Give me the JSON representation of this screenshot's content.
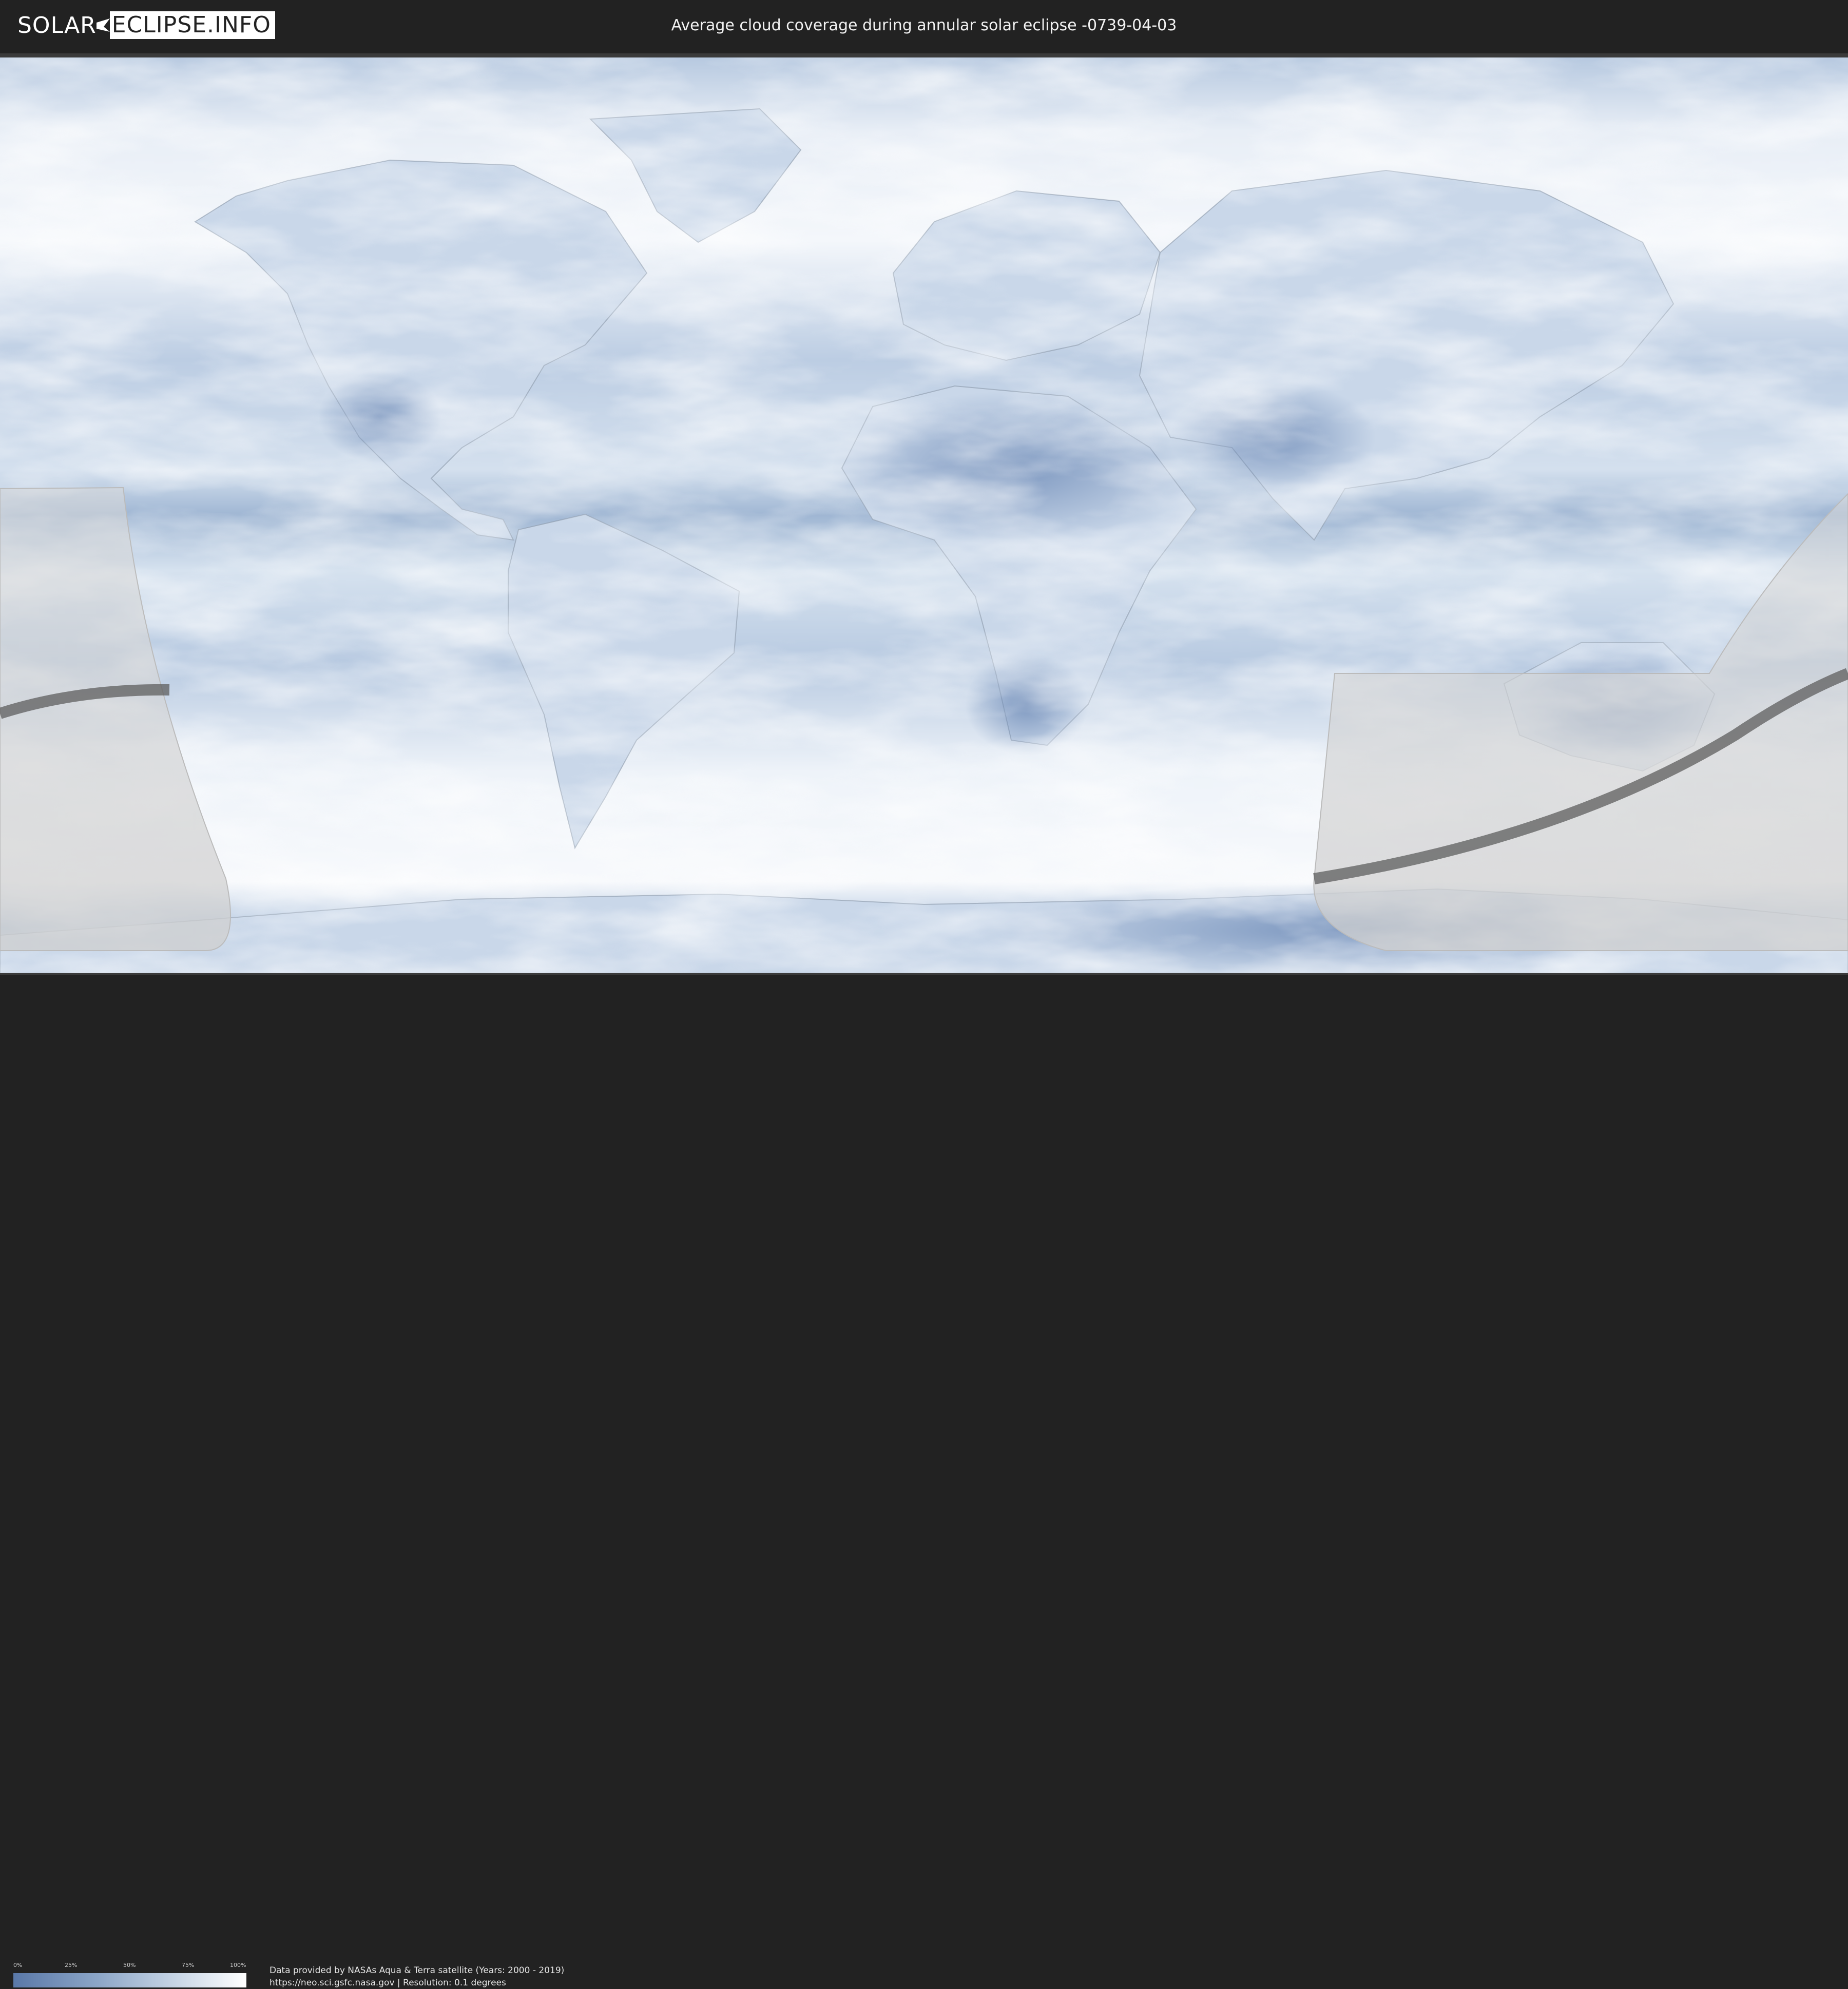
{
  "header": {
    "logo_part1": "SOLAR",
    "logo_part2": "ECLIPSE.INFO",
    "title": "Average cloud coverage during annular solar eclipse -0739-04-03"
  },
  "map": {
    "projection": "equirectangular",
    "ocean_base_color": "#c5d5e8",
    "clear_sky_color": "#5a78a8",
    "cloudy_color": "#ffffff",
    "eclipse_overlay_color": "#d9d9d9",
    "central_line_color": "#5e5e5e"
  },
  "legend": {
    "ticks": [
      "0%",
      "25%",
      "50%",
      "75%",
      "100%"
    ],
    "values": [
      0,
      25,
      50,
      75,
      100
    ]
  },
  "credits": {
    "line1": "Data provided by NASAs Aqua & Terra satellite (Years: 2000 - 2019)",
    "line2": "https://neo.sci.gsfc.nasa.gov | Resolution: 0.1 degrees"
  }
}
